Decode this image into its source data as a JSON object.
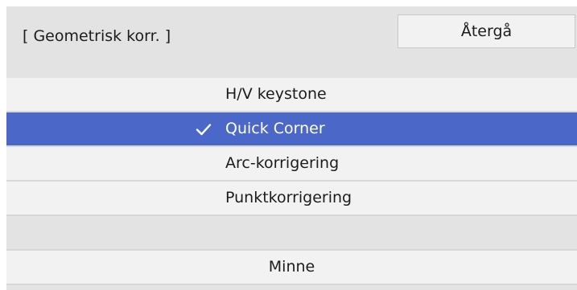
{
  "header": {
    "title": "[ Geometrisk korr. ]",
    "back_label": "Återgå"
  },
  "menu": {
    "items": [
      {
        "label": "H/V keystone",
        "selected": false
      },
      {
        "label": "Quick Corner",
        "selected": true
      },
      {
        "label": "Arc-korrigering",
        "selected": false
      },
      {
        "label": "Punktkorrigering",
        "selected": false
      }
    ],
    "memory_label": "Minne"
  },
  "colors": {
    "selected_background": "#4b68c8",
    "item_background": "#f2f2f2",
    "panel_background": "#e3e3e3"
  },
  "icons": {
    "selected_marker": "checkmark-icon"
  }
}
